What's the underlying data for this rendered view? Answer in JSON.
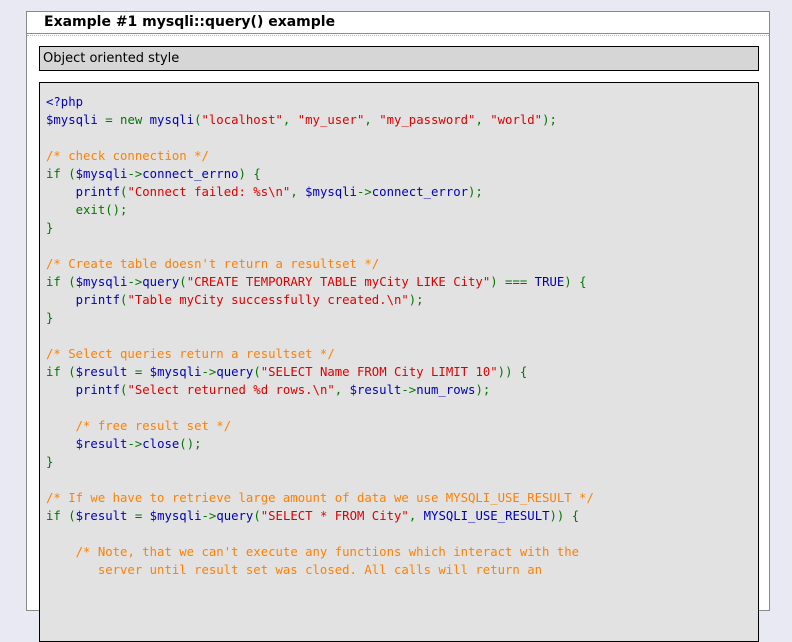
{
  "example": {
    "title": "Example #1 mysqli::query() example",
    "style_label": "Object oriented style"
  },
  "colors": {
    "keyword": "#007700",
    "default": "#0000bb",
    "string": "#dd0000",
    "comment": "#ff8000",
    "code_background": "#e2e2e2",
    "label_background": "#d6d6d6"
  },
  "code_lines": [
    [
      [
        "default",
        "<?php"
      ]
    ],
    [
      [
        "default",
        "$mysqli "
      ],
      [
        "keyword",
        "= new "
      ],
      [
        "default",
        "mysqli"
      ],
      [
        "keyword",
        "("
      ],
      [
        "string",
        "\"localhost\""
      ],
      [
        "keyword",
        ", "
      ],
      [
        "string",
        "\"my_user\""
      ],
      [
        "keyword",
        ", "
      ],
      [
        "string",
        "\"my_password\""
      ],
      [
        "keyword",
        ", "
      ],
      [
        "string",
        "\"world\""
      ],
      [
        "keyword",
        ");"
      ]
    ],
    [],
    [
      [
        "comment",
        "/* check connection */"
      ]
    ],
    [
      [
        "keyword",
        "if ("
      ],
      [
        "default",
        "$mysqli"
      ],
      [
        "keyword",
        "->"
      ],
      [
        "default",
        "connect_errno"
      ],
      [
        "keyword",
        ") {"
      ]
    ],
    [
      [
        "keyword",
        "    "
      ],
      [
        "default",
        "printf"
      ],
      [
        "keyword",
        "("
      ],
      [
        "string",
        "\"Connect failed: %s\\n\""
      ],
      [
        "keyword",
        ", "
      ],
      [
        "default",
        "$mysqli"
      ],
      [
        "keyword",
        "->"
      ],
      [
        "default",
        "connect_error"
      ],
      [
        "keyword",
        ");"
      ]
    ],
    [
      [
        "keyword",
        "    exit();"
      ]
    ],
    [
      [
        "keyword",
        "}"
      ]
    ],
    [],
    [
      [
        "comment",
        "/* Create table doesn't return a resultset */"
      ]
    ],
    [
      [
        "keyword",
        "if ("
      ],
      [
        "default",
        "$mysqli"
      ],
      [
        "keyword",
        "->"
      ],
      [
        "default",
        "query"
      ],
      [
        "keyword",
        "("
      ],
      [
        "string",
        "\"CREATE TEMPORARY TABLE myCity LIKE City\""
      ],
      [
        "keyword",
        ") === "
      ],
      [
        "default",
        "TRUE"
      ],
      [
        "keyword",
        ") {"
      ]
    ],
    [
      [
        "keyword",
        "    "
      ],
      [
        "default",
        "printf"
      ],
      [
        "keyword",
        "("
      ],
      [
        "string",
        "\"Table myCity successfully created.\\n\""
      ],
      [
        "keyword",
        ");"
      ]
    ],
    [
      [
        "keyword",
        "}"
      ]
    ],
    [],
    [
      [
        "comment",
        "/* Select queries return a resultset */"
      ]
    ],
    [
      [
        "keyword",
        "if ("
      ],
      [
        "default",
        "$result "
      ],
      [
        "keyword",
        "= "
      ],
      [
        "default",
        "$mysqli"
      ],
      [
        "keyword",
        "->"
      ],
      [
        "default",
        "query"
      ],
      [
        "keyword",
        "("
      ],
      [
        "string",
        "\"SELECT Name FROM City LIMIT 10\""
      ],
      [
        "keyword",
        ")) {"
      ]
    ],
    [
      [
        "keyword",
        "    "
      ],
      [
        "default",
        "printf"
      ],
      [
        "keyword",
        "("
      ],
      [
        "string",
        "\"Select returned %d rows.\\n\""
      ],
      [
        "keyword",
        ", "
      ],
      [
        "default",
        "$result"
      ],
      [
        "keyword",
        "->"
      ],
      [
        "default",
        "num_rows"
      ],
      [
        "keyword",
        ");"
      ]
    ],
    [],
    [
      [
        "keyword",
        "    "
      ],
      [
        "comment",
        "/* free result set */"
      ]
    ],
    [
      [
        "keyword",
        "    "
      ],
      [
        "default",
        "$result"
      ],
      [
        "keyword",
        "->"
      ],
      [
        "default",
        "close"
      ],
      [
        "keyword",
        "();"
      ]
    ],
    [
      [
        "keyword",
        "}"
      ]
    ],
    [],
    [
      [
        "comment",
        "/* If we have to retrieve large amount of data we use MYSQLI_USE_RESULT */"
      ]
    ],
    [
      [
        "keyword",
        "if ("
      ],
      [
        "default",
        "$result "
      ],
      [
        "keyword",
        "= "
      ],
      [
        "default",
        "$mysqli"
      ],
      [
        "keyword",
        "->"
      ],
      [
        "default",
        "query"
      ],
      [
        "keyword",
        "("
      ],
      [
        "string",
        "\"SELECT * FROM City\""
      ],
      [
        "keyword",
        ", "
      ],
      [
        "default",
        "MYSQLI_USE_RESULT"
      ],
      [
        "keyword",
        ")) {"
      ]
    ],
    [],
    [
      [
        "keyword",
        "    "
      ],
      [
        "comment",
        "/* Note, that we can't execute any functions which interact with the"
      ]
    ],
    [
      [
        "comment",
        "       server until result set was closed. All calls will return an"
      ]
    ]
  ]
}
